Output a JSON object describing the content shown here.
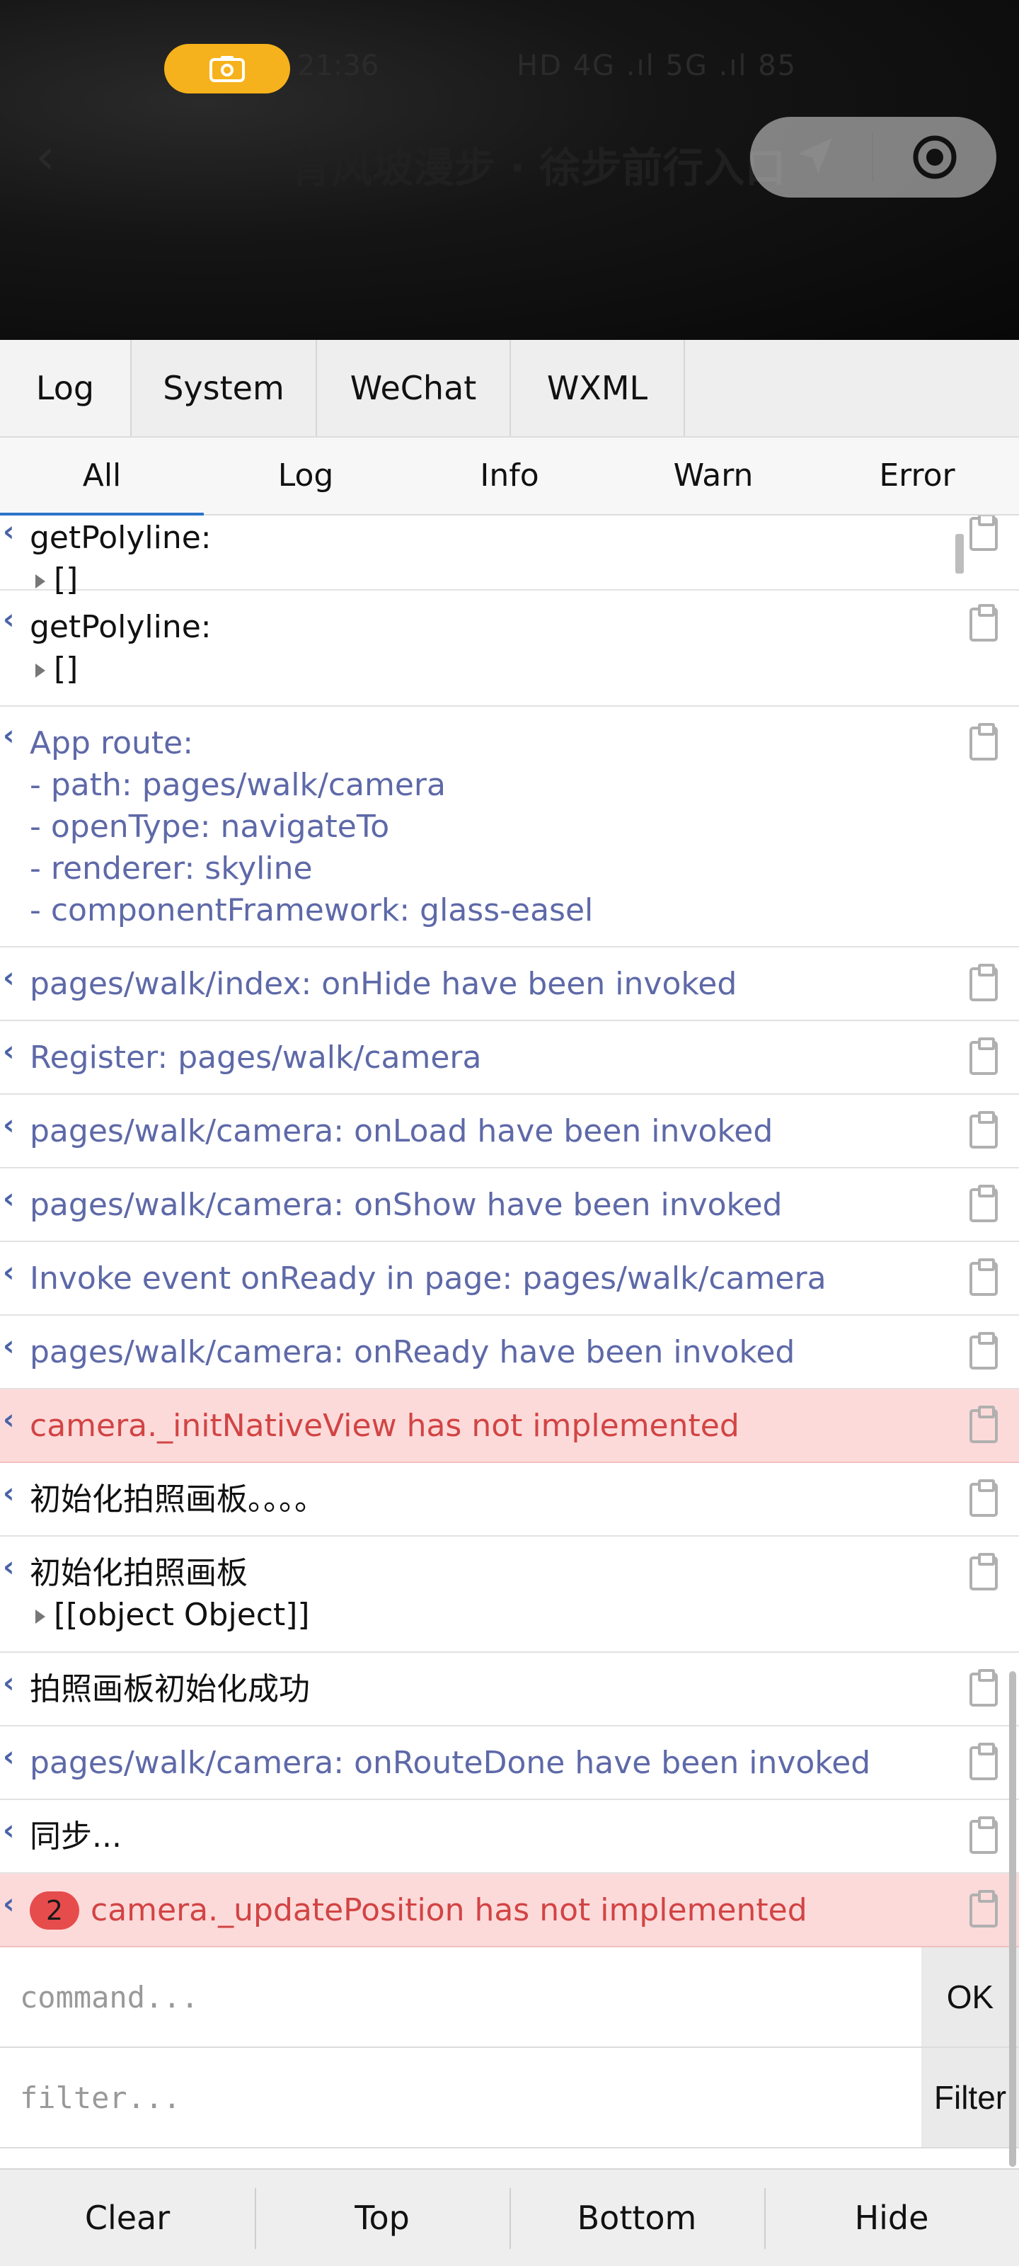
{
  "camera_view": {
    "status_time": "21:36",
    "background_title": "背风坡漫步 · 徐步前行入口",
    "status_right": "HD 4G .ıl 5G .ıl 85"
  },
  "tabs": [
    {
      "label": "Log",
      "active": true
    },
    {
      "label": "System",
      "active": false
    },
    {
      "label": "WeChat",
      "active": false
    },
    {
      "label": "WXML",
      "active": false
    }
  ],
  "filters": [
    {
      "label": "All",
      "active": true
    },
    {
      "label": "Log",
      "active": false
    },
    {
      "label": "Info",
      "active": false
    },
    {
      "label": "Warn",
      "active": false
    },
    {
      "label": "Error",
      "active": false
    }
  ],
  "logs": [
    {
      "lines": [
        "getPolyline:",
        "[]"
      ],
      "level": "log"
    },
    {
      "lines": [
        "getPolyline:",
        "[]"
      ],
      "level": "log"
    },
    {
      "lines": [
        "App route:",
        "- path: pages/walk/camera",
        "- openType: navigateTo",
        "- renderer: skyline",
        "- componentFramework: glass-easel"
      ],
      "level": "info"
    },
    {
      "lines": [
        "pages/walk/index: onHide have been invoked"
      ],
      "level": "info"
    },
    {
      "lines": [
        "Register: pages/walk/camera"
      ],
      "level": "info"
    },
    {
      "lines": [
        "pages/walk/camera: onLoad have been invoked"
      ],
      "level": "info"
    },
    {
      "lines": [
        "pages/walk/camera: onShow have been invoked"
      ],
      "level": "info"
    },
    {
      "lines": [
        "Invoke event onReady in page: pages/walk/camera"
      ],
      "level": "info"
    },
    {
      "lines": [
        "pages/walk/camera: onReady have been invoked"
      ],
      "level": "info"
    },
    {
      "lines": [
        "camera._initNativeView has not implemented"
      ],
      "level": "error"
    },
    {
      "lines": [
        "初始化拍照画板。。。。"
      ],
      "level": "log"
    },
    {
      "lines": [
        "初始化拍照画板",
        "[[object Object]]"
      ],
      "level": "log"
    },
    {
      "lines": [
        "拍照画板初始化成功"
      ],
      "level": "log"
    },
    {
      "lines": [
        "pages/walk/camera: onRouteDone have been invoked"
      ],
      "level": "info"
    },
    {
      "lines": [
        "同步..."
      ],
      "level": "log"
    },
    {
      "lines": [
        "camera._updatePosition has not implemented"
      ],
      "level": "error",
      "repeat": "2"
    }
  ],
  "command": {
    "placeholder": "command...",
    "button": "OK"
  },
  "filter": {
    "placeholder": "filter...",
    "button": "Filter"
  },
  "toolbar": [
    "Clear",
    "Top",
    "Bottom",
    "Hide"
  ],
  "colors": {
    "info": "#5e69a8",
    "error_text": "#d24444",
    "error_bg": "#fddada",
    "accent": "#f6b21c"
  }
}
